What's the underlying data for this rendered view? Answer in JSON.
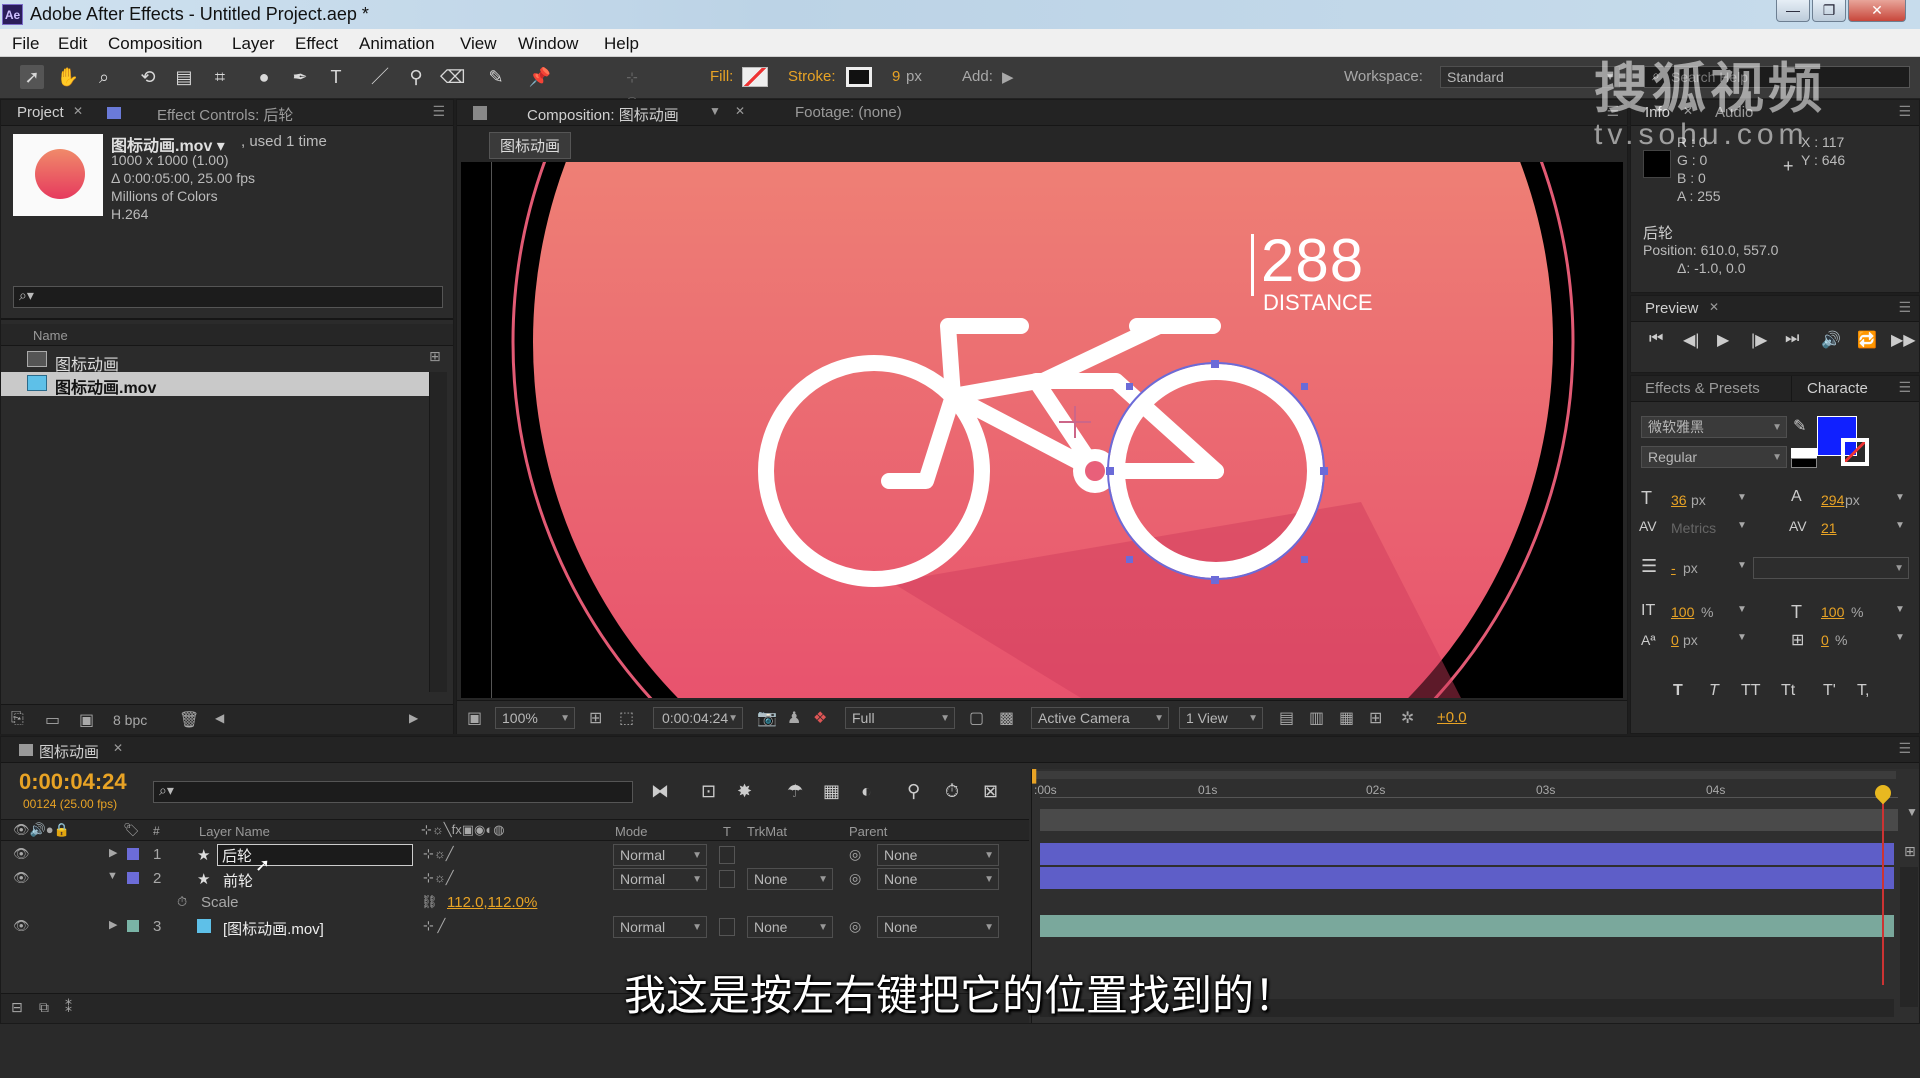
{
  "window": {
    "app_logo": "Ae",
    "title": "Adobe After Effects - Untitled Project.aep *",
    "buttons": [
      "—",
      "❐",
      "✕"
    ]
  },
  "menu": [
    "File",
    "Edit",
    "Composition",
    "Layer",
    "Effect",
    "Animation",
    "View",
    "Window",
    "Help"
  ],
  "toolbar": {
    "fill_label": "Fill:",
    "stroke_label": "Stroke:",
    "stroke_width": "9",
    "stroke_unit": "px",
    "add_label": "Add:",
    "workspace_label": "Workspace:",
    "workspace_value": "Standard",
    "search_placeholder": "Search Help"
  },
  "project_panel": {
    "tab_project": "Project",
    "tab_effect_controls": "Effect Controls: 后轮",
    "item_name": "图标动画.mov ▾",
    "used_text": ", used 1 time",
    "info_lines": [
      "1000 x 1000 (1.00)",
      "Δ 0:00:05:00, 25.00 fps",
      "Millions of Colors",
      "H.264"
    ],
    "column_name": "Name",
    "items": [
      "图标动画",
      "图标动画.mov"
    ],
    "bpc": "8 bpc"
  },
  "comp_panel": {
    "tab_comp": "Composition: 图标动画",
    "tab_footage": "Footage: (none)",
    "breadcrumb": "图标动画",
    "distance_number": "288",
    "distance_label": "DISTANCE",
    "zoom": "100%",
    "timecode": "0:00:04:24",
    "resolution": "Full",
    "camera": "Active Camera",
    "views": "1 View",
    "exposure": "+0.0"
  },
  "info_panel": {
    "tab_info": "Info",
    "tab_audio": "Audio",
    "r": "R : 0",
    "g": "G : 0",
    "b": "B : 0",
    "a": "A : 255",
    "x": "X : 117",
    "y": "Y : 646",
    "layer_name": "后轮",
    "position": "Position: 610.0, 557.0",
    "delta": "Δ: -1.0, 0.0"
  },
  "preview_panel": {
    "tab": "Preview"
  },
  "character_panel": {
    "tab_effects": "Effects & Presets",
    "tab_character": "Characte",
    "font_family": "微软雅黑",
    "font_style": "Regular",
    "font_size": "36",
    "font_size_unit": "px",
    "leading": "294",
    "leading_unit": "px",
    "kerning": "Metrics",
    "tracking": "21",
    "stroke_width": "-",
    "stroke_unit": "px",
    "vscale": "100",
    "hscale": "100",
    "baseline": "0",
    "baseline_unit": "px",
    "tsume": "0",
    "percent": "%",
    "format_buttons": [
      "T",
      "T",
      "TT",
      "Tt",
      "T'",
      "T,"
    ],
    "fill_color": "#1020ff",
    "stroke_color": "#ffffff"
  },
  "timeline": {
    "tab": "图标动画",
    "timecode": "0:00:04:24",
    "frame_info": "00124 (25.00 fps)",
    "columns": {
      "layer_name": "Layer Name",
      "mode": "Mode",
      "t": "T",
      "trkmat": "TrkMat",
      "parent": "Parent"
    },
    "ruler": [
      ":00s",
      "01s",
      "02s",
      "03s",
      "04s"
    ],
    "layers": [
      {
        "num": "1",
        "name": "后轮",
        "mode": "Normal",
        "trkmat": "",
        "parent": "None",
        "color": "#6c6cd8"
      },
      {
        "num": "2",
        "name": "前轮",
        "mode": "Normal",
        "trkmat": "None",
        "parent": "None",
        "color": "#6c6cd8"
      },
      {
        "num": "3",
        "name": "[图标动画.mov]",
        "mode": "Normal",
        "trkmat": "None",
        "parent": "None",
        "color": "#7ab4a6"
      }
    ],
    "scale_prop": {
      "label": "Scale",
      "value": "112.0,112.0%"
    }
  },
  "subtitle": "我这是按左右键把它的位置找到的！",
  "watermark": {
    "line1": "搜狐视频",
    "line2": "tv.sohu.com"
  },
  "colors": {
    "orange": "#e8a325",
    "bar_purple": "#5e5ec8",
    "bar_teal": "#7aa89c",
    "comp_top": "#f19a7a",
    "comp_bottom": "#e6486a"
  }
}
